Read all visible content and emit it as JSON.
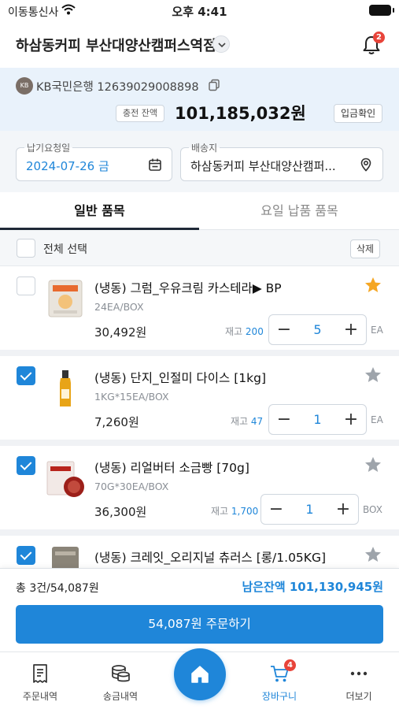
{
  "status_bar": {
    "carrier": "이동통신사",
    "time": "오후 4:41"
  },
  "header": {
    "store_name": "하삼동커피 부산대양산캠퍼스역점",
    "notification_count": "2"
  },
  "account": {
    "bank_logo": "KB",
    "bank_account": "KB국민은행 12639029008898",
    "charge_label": "충전 잔액",
    "charge_amount": "101,185,032원",
    "deposit_check": "입금확인"
  },
  "fields": {
    "delivery_date_label": "납기요청일",
    "delivery_date_value": "2024-07-26 금",
    "ship_to_label": "배송지",
    "ship_to_value": "하삼동커피 부산대양산캠퍼..."
  },
  "tabs": {
    "general": "일반 품목",
    "weekday": "요일 납품 품목"
  },
  "select_bar": {
    "select_all": "전체 선택",
    "delete": "삭제"
  },
  "items": [
    {
      "name": "(냉동) 그럼_우유크림 카스테라▶ BP",
      "spec": "24EA/BOX",
      "price": "30,492원",
      "stock_label": "재고",
      "stock": "200",
      "qty": "5",
      "unit": "EA"
    },
    {
      "name": "(냉동) 단지_인절미 다이스 [1kg]",
      "spec": "1KG*15EA/BOX",
      "price": "7,260원",
      "stock_label": "재고",
      "stock": "47",
      "qty": "1",
      "unit": "EA"
    },
    {
      "name": "(냉동) 리얼버터 소금빵 [70g]",
      "spec": "70G*30EA/BOX",
      "price": "36,300원",
      "stock_label": "재고",
      "stock": "1,700",
      "qty": "1",
      "unit": "BOX"
    },
    {
      "name": "(냉동) 크레잇_오리지널 츄러스 [롱/1.05KG]"
    }
  ],
  "summary": {
    "total": "총 3건/54,087원",
    "remaining": "남은잔액 101,130,945원",
    "order_button": "54,087원 주문하기"
  },
  "bottom_nav": {
    "orders": "주문내역",
    "transfers": "송금내역",
    "cart": "장바구니",
    "cart_count": "4",
    "more": "더보기"
  },
  "colors": {
    "accent": "#1f86d9",
    "star_active": "#f5a623",
    "star_inactive": "#9ea4ab",
    "badge": "#e8443a"
  }
}
